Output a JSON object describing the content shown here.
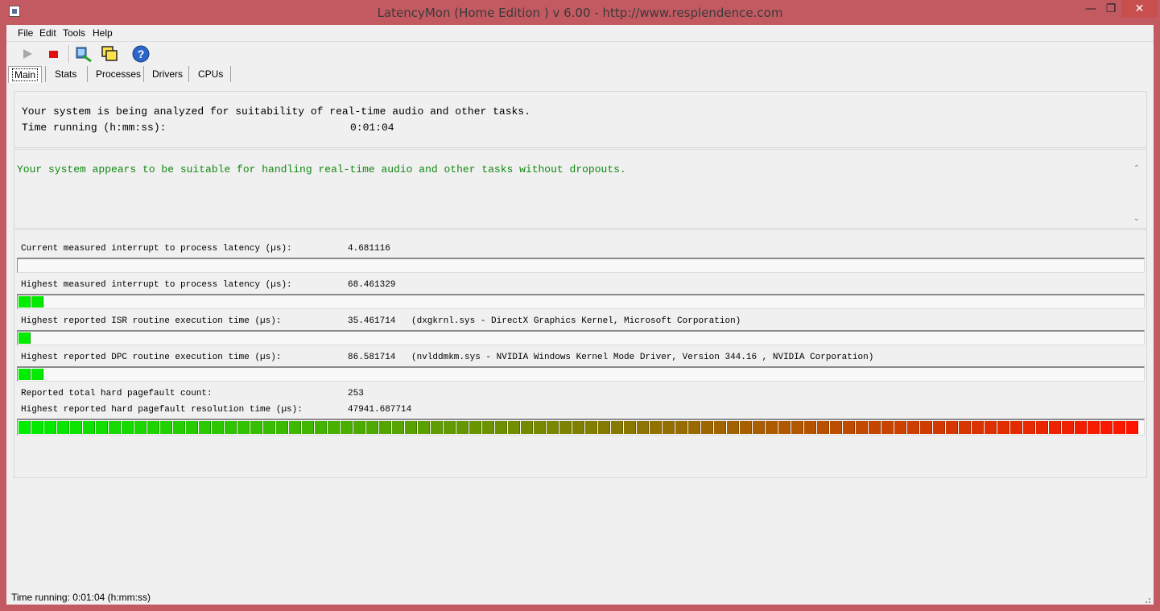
{
  "window": {
    "title": "LatencyMon  (Home Edition )  v 6.00 - http://www.resplendence.com",
    "minimize_glyph": "—",
    "maximize_glyph": "❐",
    "close_glyph": "✕"
  },
  "menu": {
    "items": [
      "File",
      "Edit",
      "Tools",
      "Help"
    ]
  },
  "toolbar": {
    "buttons": [
      {
        "icon": "play-icon",
        "enabled": false
      },
      {
        "icon": "stop-icon",
        "enabled": true
      },
      {
        "icon": "analyze-icon",
        "enabled": true
      },
      {
        "icon": "windows-icon",
        "enabled": true
      },
      {
        "icon": "help-icon",
        "enabled": true
      }
    ]
  },
  "tabs": [
    "Main",
    "Stats",
    "Processes",
    "Drivers",
    "CPUs"
  ],
  "active_tab": "Main",
  "status_panel": {
    "line1": "Your system is being analyzed for suitability of real-time audio and other tasks.",
    "time_label": "Time running (h:mm:ss):",
    "time_value": "0:01:04"
  },
  "verdict": {
    "message": "Your system appears to be suitable for handling real-time audio and other tasks without dropouts.",
    "color": "#118811",
    "scroll_up": "⌃",
    "scroll_down": "⌄"
  },
  "metrics": {
    "current_latency": {
      "label": "Current measured interrupt to process latency (µs):",
      "value": "4.681116",
      "bar_fraction": 0.0
    },
    "highest_latency": {
      "label": "Highest measured interrupt to process latency (µs):",
      "value": "68.461329",
      "bar_fraction": 0.02
    },
    "isr": {
      "label": "Highest reported ISR routine execution time (µs):",
      "value": "35.461714",
      "detail": "(dxgkrnl.sys - DirectX Graphics Kernel, Microsoft Corporation)",
      "bar_fraction": 0.01
    },
    "dpc": {
      "label": "Highest reported DPC routine execution time (µs):",
      "value": "86.581714",
      "detail": "(nvlddmkm.sys - NVIDIA Windows Kernel Mode Driver, Version 344.16 , NVIDIA Corporation)",
      "bar_fraction": 0.02
    },
    "pagefault_count": {
      "label": "Reported total hard pagefault count:",
      "value": "253"
    },
    "pagefault_time": {
      "label": "Highest reported hard pagefault resolution time (µs):",
      "value": "47941.687714",
      "bar_fraction": 1.0
    }
  },
  "colors": {
    "bar_start": "#00ff00",
    "bar_end": "#ff0000"
  },
  "statusbar": {
    "text": "Time running: 0:01:04  (h:mm:ss)"
  }
}
